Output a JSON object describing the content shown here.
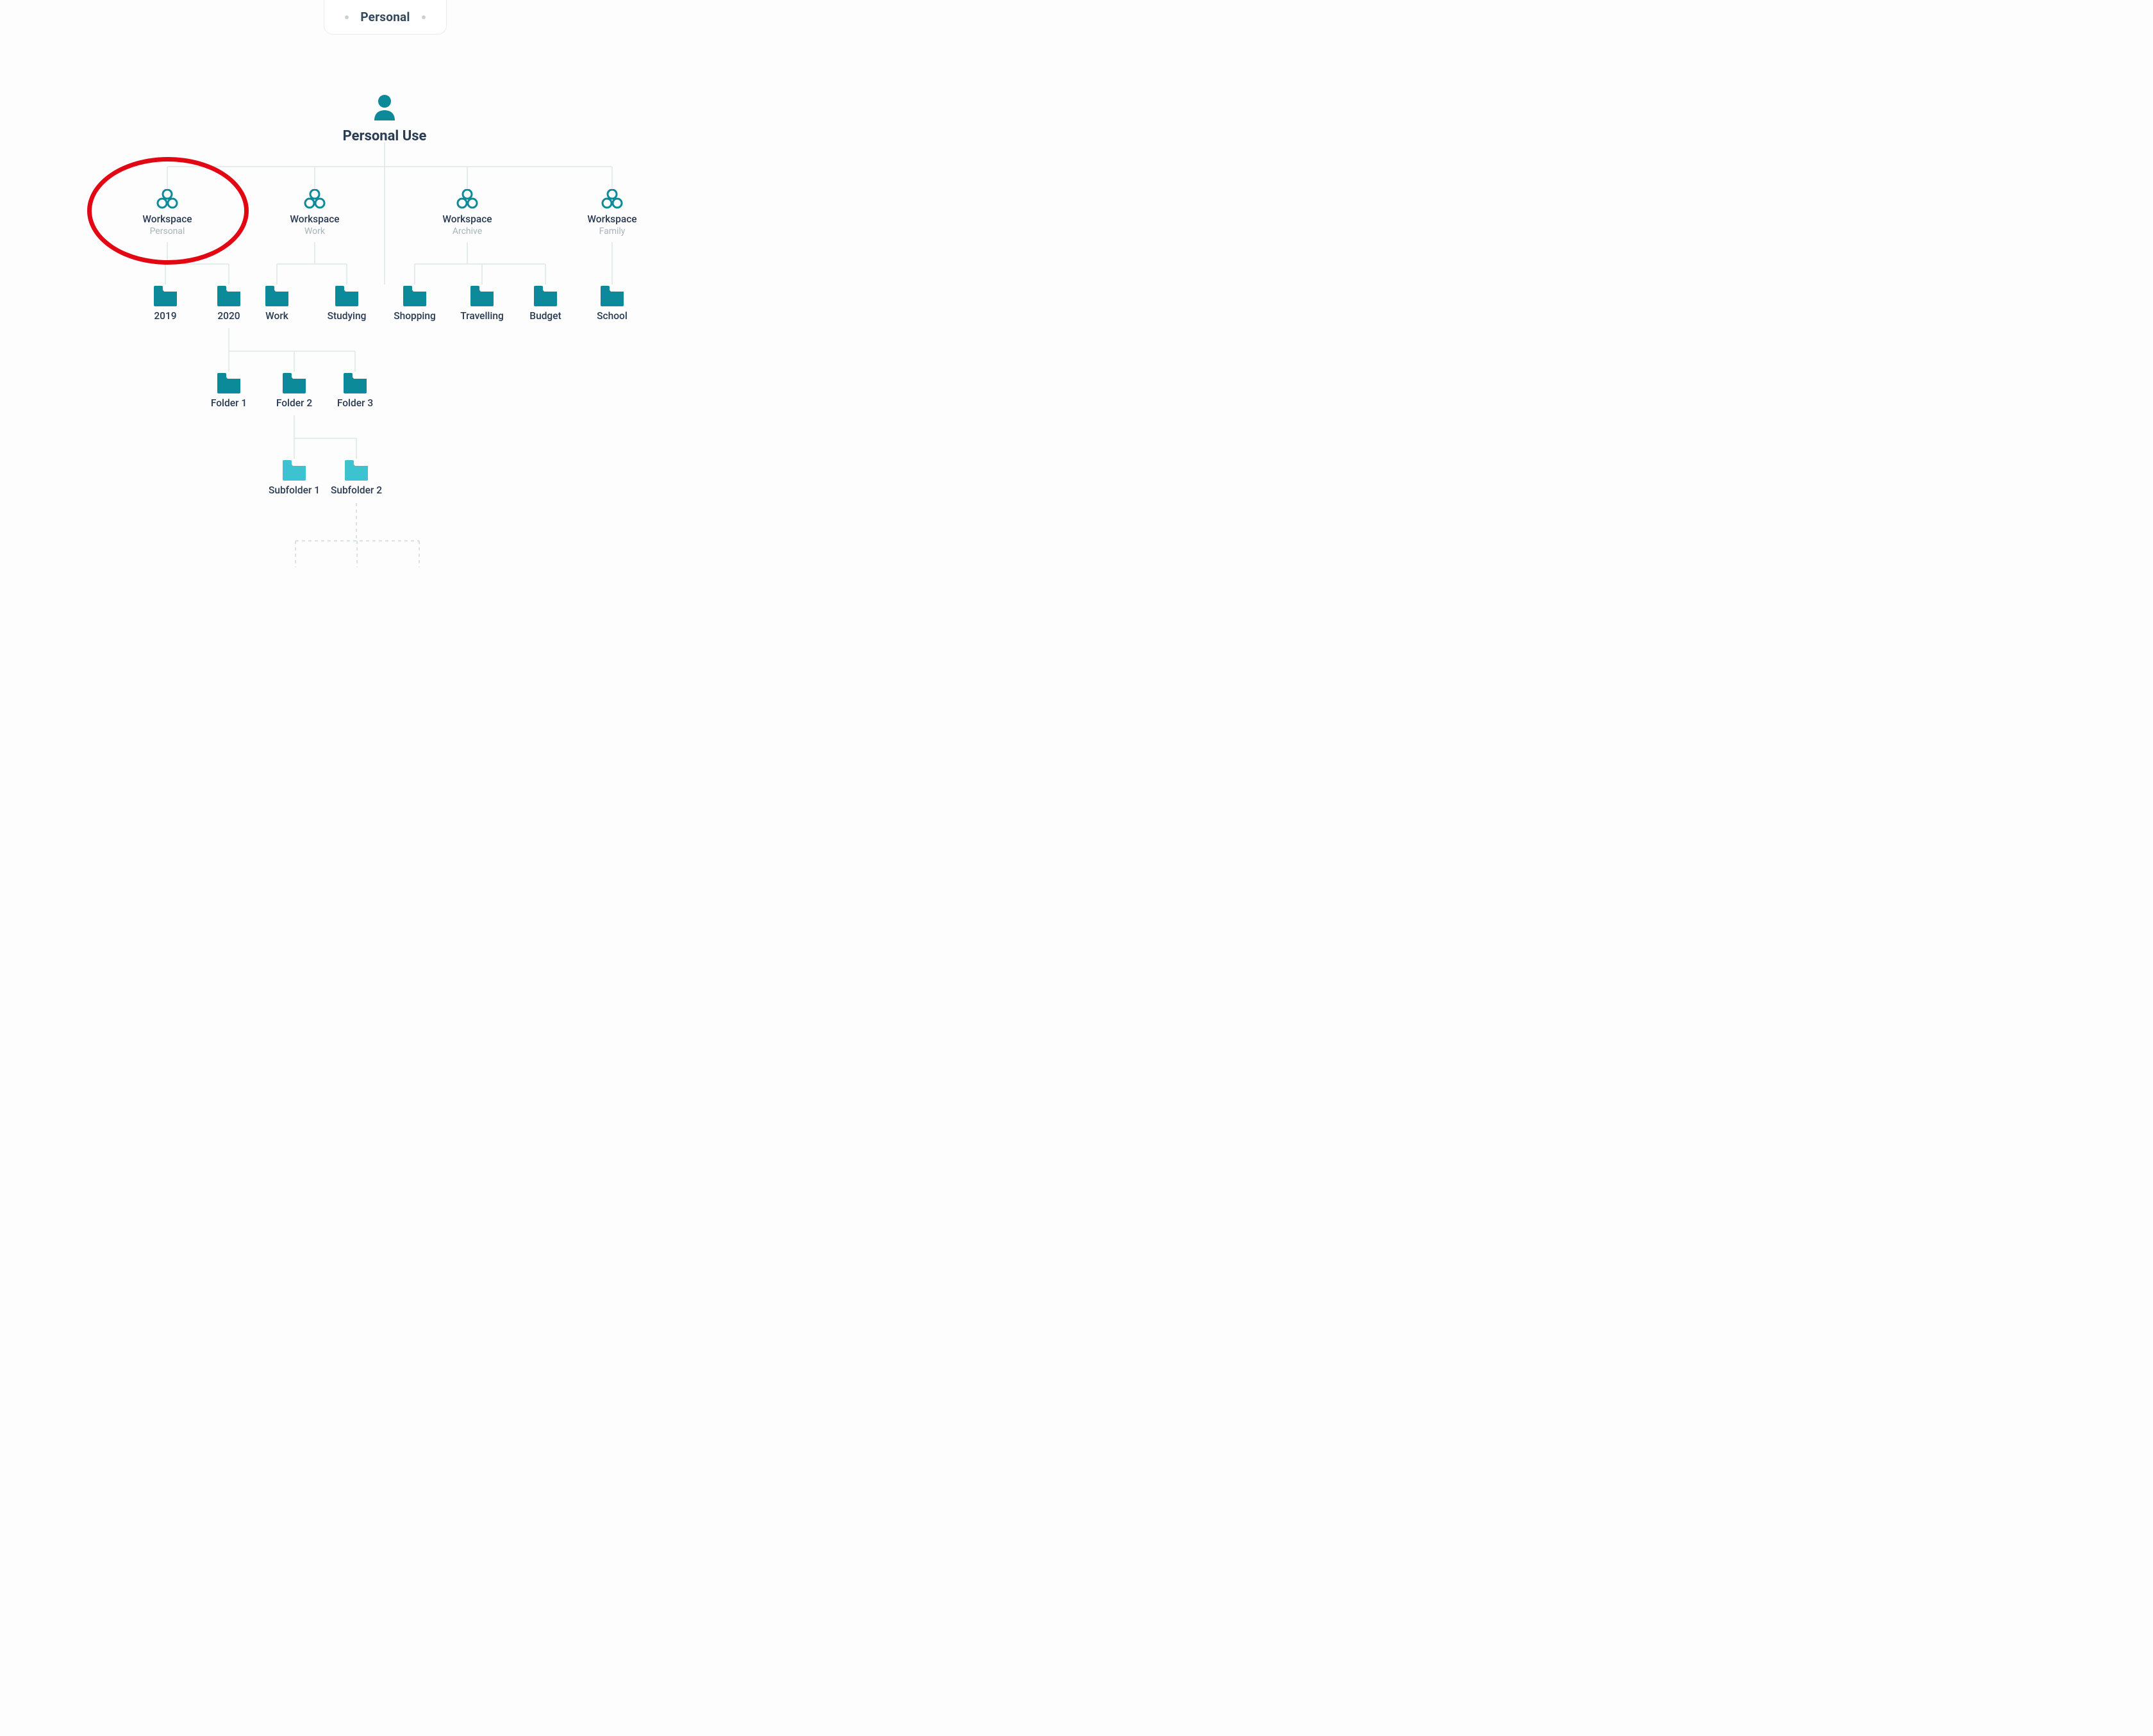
{
  "tab": {
    "label": "Personal"
  },
  "root": {
    "label": "Personal Use"
  },
  "workspaces": [
    {
      "title": "Workspace",
      "subtitle": "Personal"
    },
    {
      "title": "Workspace",
      "subtitle": "Work"
    },
    {
      "title": "Workspace",
      "subtitle": "Archive"
    },
    {
      "title": "Workspace",
      "subtitle": "Family"
    }
  ],
  "folders_row1": [
    {
      "label": "2019"
    },
    {
      "label": "2020"
    },
    {
      "label": "Work"
    },
    {
      "label": "Studying"
    },
    {
      "label": "Shopping"
    },
    {
      "label": "Travelling"
    },
    {
      "label": "Budget"
    },
    {
      "label": "School"
    }
  ],
  "folders_row2": [
    {
      "label": "Folder 1"
    },
    {
      "label": "Folder 2"
    },
    {
      "label": "Folder 3"
    }
  ],
  "folders_row3": [
    {
      "label": "Subfolder 1"
    },
    {
      "label": "Subfolder 2"
    }
  ],
  "colors": {
    "teal": "#0d8a9a",
    "teal_light": "#3cc3cf",
    "line": "#dbe6e8",
    "dashed": "#cfd9db"
  }
}
